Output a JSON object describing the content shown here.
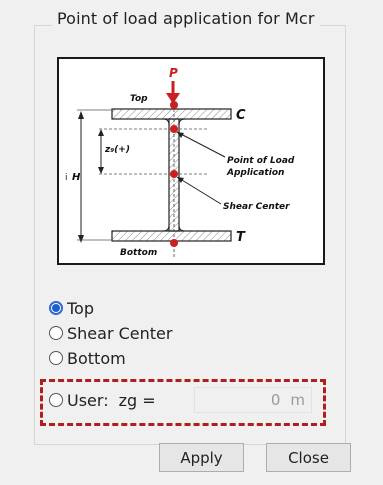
{
  "group": {
    "title": "Point of load application for Mcr"
  },
  "diagram": {
    "label_p": "P",
    "label_top": "Top",
    "label_bottom": "Bottom",
    "label_c": "C",
    "label_t": "T",
    "label_zg": "z₉(+)",
    "label_h": "H",
    "label_point_of_load": "Point of Load",
    "label_application": "Application",
    "label_shear_center": "Shear Center",
    "accent_color": "#cc1f1f"
  },
  "options": {
    "top": "Top",
    "shear_center": "Shear Center",
    "bottom": "Bottom",
    "user": "User:",
    "zg_label": "zg ="
  },
  "selected_option": "Top",
  "user_input": {
    "value": "0",
    "unit": "m"
  },
  "buttons": {
    "apply": "Apply",
    "close": "Close"
  }
}
